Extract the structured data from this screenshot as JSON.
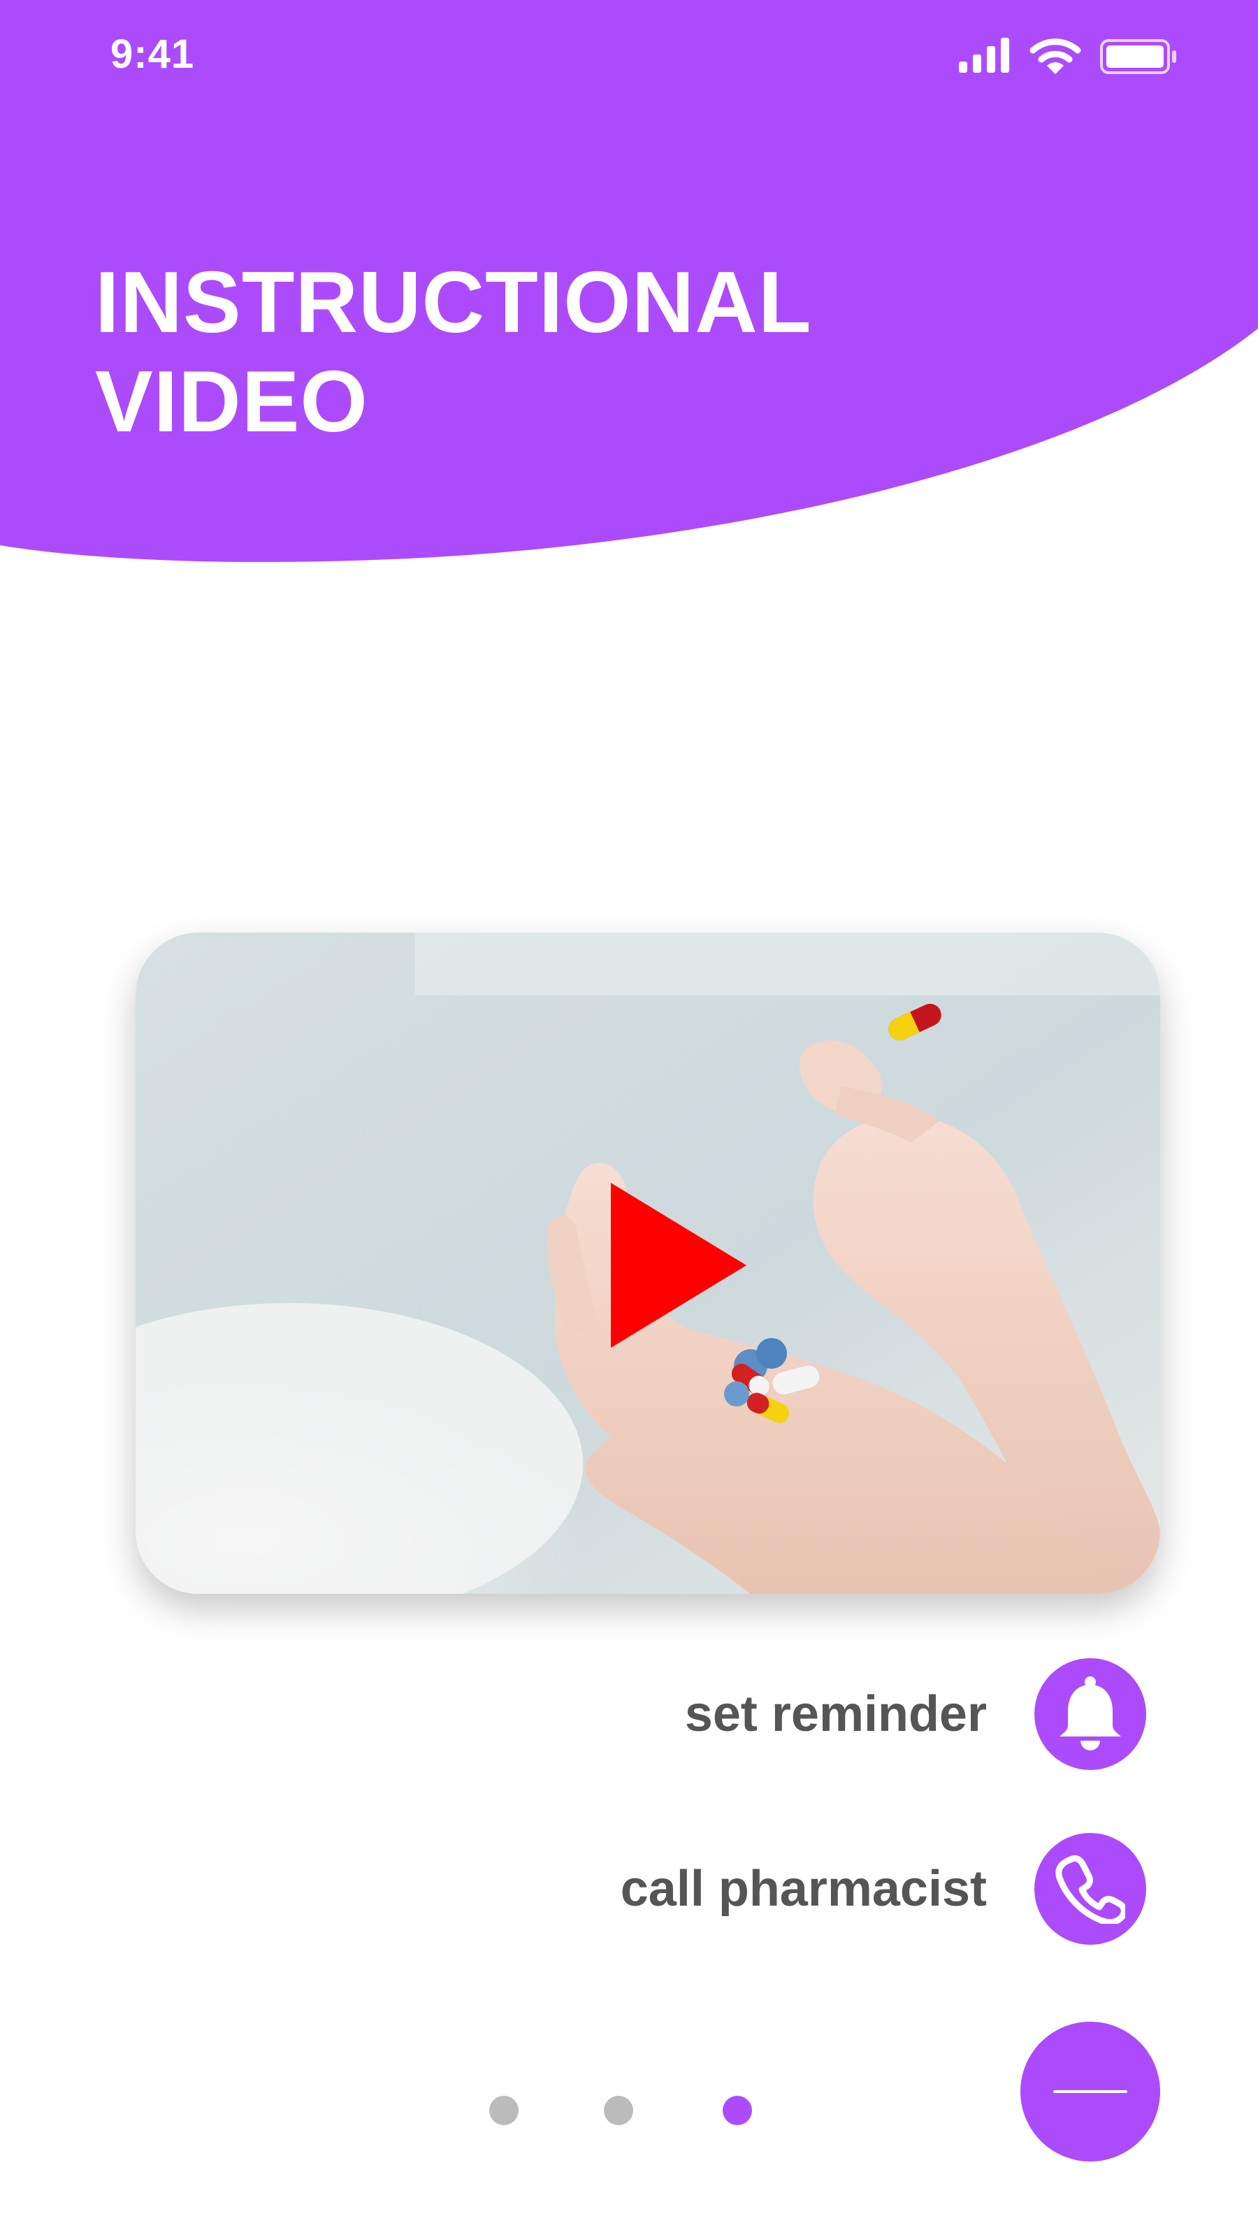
{
  "status_bar": {
    "time": "9:41",
    "icons": [
      "signal-icon",
      "wifi-icon",
      "battery-icon"
    ]
  },
  "header": {
    "title_line1": "INSTRUCTIONAL",
    "title_line2": "VIDEO"
  },
  "video": {
    "play_icon": "play-icon"
  },
  "actions": {
    "reminder_label": "set reminder",
    "reminder_icon": "bell-icon",
    "call_label": "call pharmacist",
    "call_icon": "phone-icon"
  },
  "pagination": {
    "total": 3,
    "active_index": 2
  },
  "fab": {
    "icon": "minus-icon"
  },
  "colors": {
    "accent": "#ac4bfb",
    "play": "#ff0000",
    "text": "#555555",
    "dot_inactive": "#bbbbbb"
  }
}
